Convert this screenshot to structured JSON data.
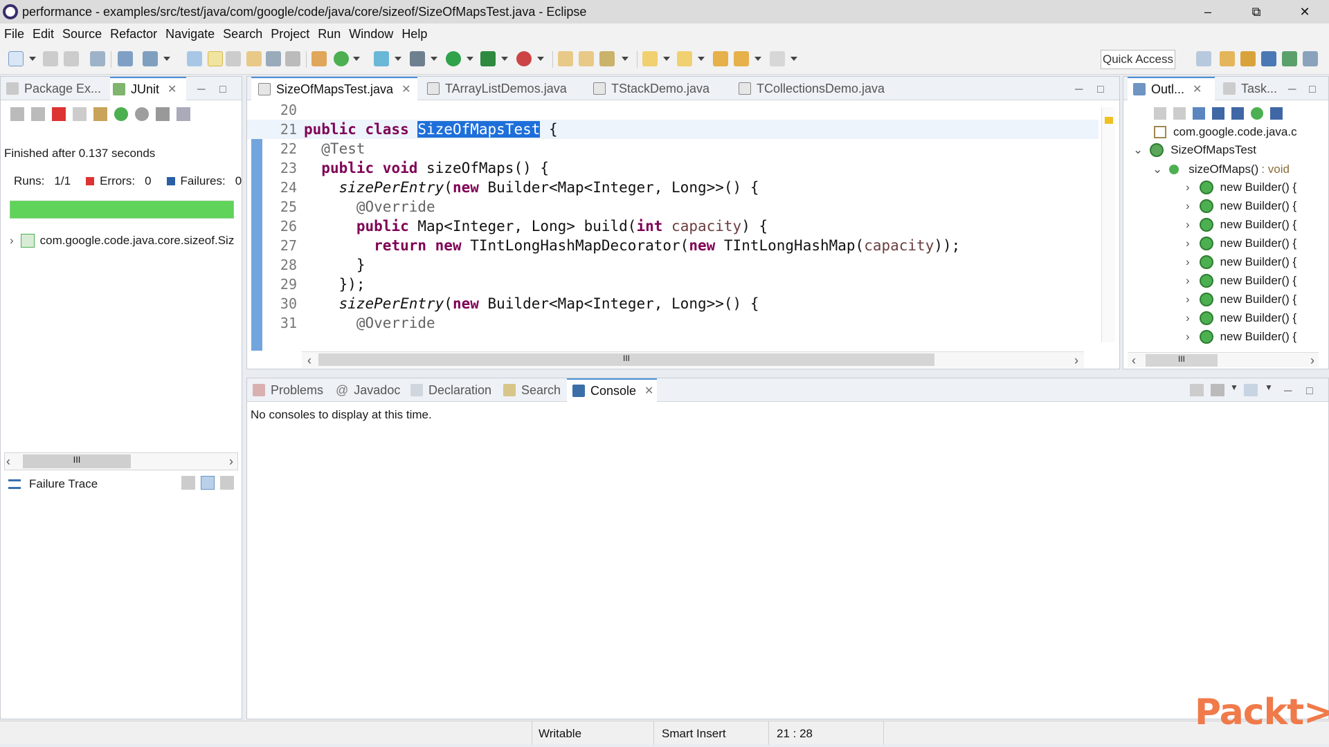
{
  "window": {
    "title": "performance - examples/src/test/java/com/google/code/java/core/sizeof/SizeOfMapsTest.java - Eclipse",
    "controls": [
      "–",
      "⧉",
      "✕"
    ]
  },
  "menu": [
    "File",
    "Edit",
    "Source",
    "Refactor",
    "Navigate",
    "Search",
    "Project",
    "Run",
    "Window",
    "Help"
  ],
  "toolbar": {
    "quick_access": "Quick Access"
  },
  "left_panel": {
    "tabs": [
      {
        "label": "Package Ex..."
      },
      {
        "label": "JUnit",
        "close": "✕"
      }
    ],
    "finished": "Finished after 0.137 seconds",
    "runs_label": "Runs:",
    "runs_value": "1/1",
    "errors_label": "Errors:",
    "errors_value": "0",
    "failures_label": "Failures:",
    "failures_value": "0",
    "progress": 1.0,
    "test_node": "com.google.code.java.core.sizeof.Siz",
    "failure_trace": "Failure Trace",
    "scroll_glyph": "III"
  },
  "editor": {
    "tabs": [
      {
        "label": "SizeOfMapsTest.java",
        "close": "✕"
      },
      {
        "label": "TArrayListDemos.java"
      },
      {
        "label": "TStackDemo.java"
      },
      {
        "label": "TCollectionsDemo.java"
      }
    ],
    "lines": [
      {
        "n": "20",
        "text": ""
      },
      {
        "n": "21",
        "text": "public class SizeOfMapsTest {"
      },
      {
        "n": "22",
        "text": "  @Test"
      },
      {
        "n": "23",
        "text": "  public void sizeOfMaps() {"
      },
      {
        "n": "24",
        "text": "    sizePerEntry(new Builder<Map<Integer, Long>>() {"
      },
      {
        "n": "25",
        "text": "      @Override"
      },
      {
        "n": "26",
        "text": "      public Map<Integer, Long> build(int capacity) {"
      },
      {
        "n": "27",
        "text": "        return new TIntLongHashMapDecorator(new TIntLongHashMap(capacity));"
      },
      {
        "n": "28",
        "text": "      }"
      },
      {
        "n": "29",
        "text": "    });"
      },
      {
        "n": "30",
        "text": "    sizePerEntry(new Builder<Map<Integer, Long>>() {"
      },
      {
        "n": "31",
        "text": "      @Override"
      }
    ],
    "scroll_glyph": "III"
  },
  "outline": {
    "tabs": [
      {
        "label": "Outl...",
        "close": "✕"
      },
      {
        "label": "Task..."
      }
    ],
    "package": "com.google.code.java.c",
    "class": "SizeOfMapsTest",
    "method": "sizeOfMaps()",
    "method_type": ": void",
    "builders": [
      "new Builder() {",
      "new Builder() {",
      "new Builder() {",
      "new Builder() {",
      "new Builder() {",
      "new Builder() {",
      "new Builder() {",
      "new Builder() {",
      "new Builder() {"
    ],
    "scroll_glyph": "III"
  },
  "bottom_panel": {
    "tabs": [
      {
        "label": "Problems"
      },
      {
        "label": "Javadoc"
      },
      {
        "label": "Declaration"
      },
      {
        "label": "Search"
      },
      {
        "label": "Console",
        "close": "✕"
      }
    ],
    "message": "No consoles to display at this time."
  },
  "status": {
    "mode": "Writable",
    "insert": "Smart Insert",
    "position": "21 : 28"
  },
  "watermark": "Packt>"
}
